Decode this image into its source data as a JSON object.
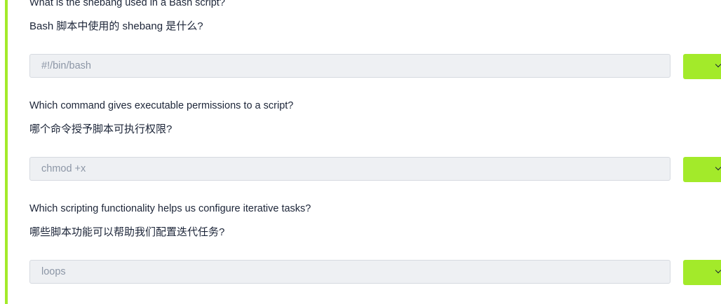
{
  "questions": [
    {
      "question_en": "What is the shebang used in a Bash script?",
      "question_zh": "Bash 脚本中使用的 shebang 是什么?",
      "answer": "#!/bin/bash"
    },
    {
      "question_en": "Which command gives executable permissions to a script?",
      "question_zh": "哪个命令授予脚本可执行权限?",
      "answer": "chmod +x"
    },
    {
      "question_en": "Which scripting functionality helps us configure iterative tasks?",
      "question_zh": "哪些脚本功能可以帮助我们配置迭代任务?",
      "answer": "loops"
    }
  ],
  "accent_color": "#a3ea2a",
  "submit_icon": "chevron-down-icon"
}
